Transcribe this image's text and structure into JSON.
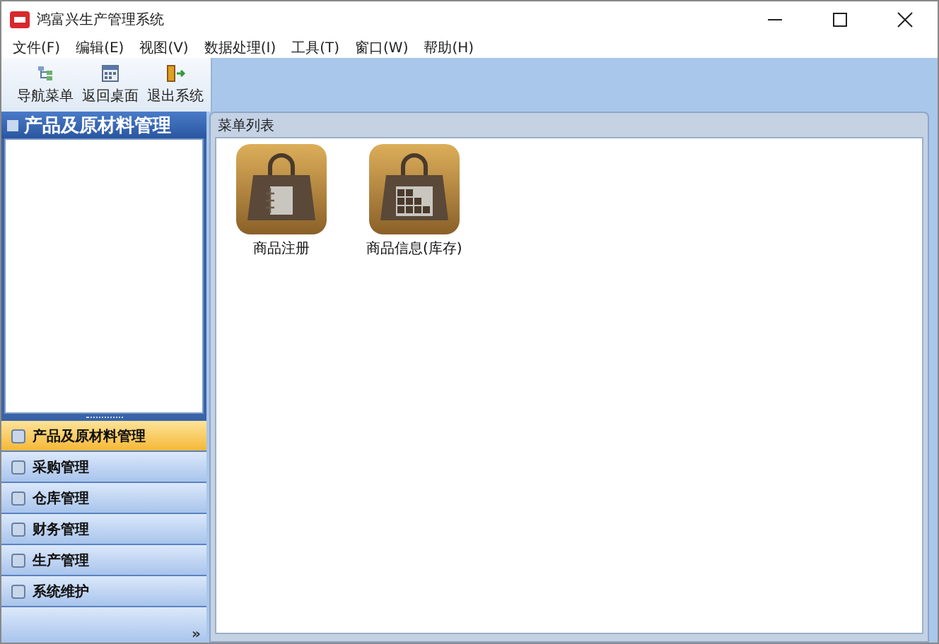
{
  "window": {
    "title": "鸿富兴生产管理系统"
  },
  "menu": [
    "文件(F)",
    "编辑(E)",
    "视图(V)",
    "数据处理(I)",
    "工具(T)",
    "窗口(W)",
    "帮助(H)"
  ],
  "toolbar": [
    {
      "label": "导航菜单",
      "kind": "tree"
    },
    {
      "label": "返回桌面",
      "kind": "desktop"
    },
    {
      "label": "退出系统",
      "kind": "exit"
    }
  ],
  "sidebar": {
    "title": "产品及原材料管理",
    "items": [
      {
        "label": "产品及原材料管理",
        "selected": true
      },
      {
        "label": "采购管理",
        "selected": false
      },
      {
        "label": "仓库管理",
        "selected": false
      },
      {
        "label": "财务管理",
        "selected": false
      },
      {
        "label": "生产管理",
        "selected": false
      },
      {
        "label": "系统维护",
        "selected": false
      }
    ],
    "more": "»"
  },
  "content": {
    "title": "菜单列表",
    "items": [
      {
        "label": "商品注册",
        "kind": "register"
      },
      {
        "label": "商品信息(库存)",
        "kind": "inventory"
      }
    ]
  }
}
